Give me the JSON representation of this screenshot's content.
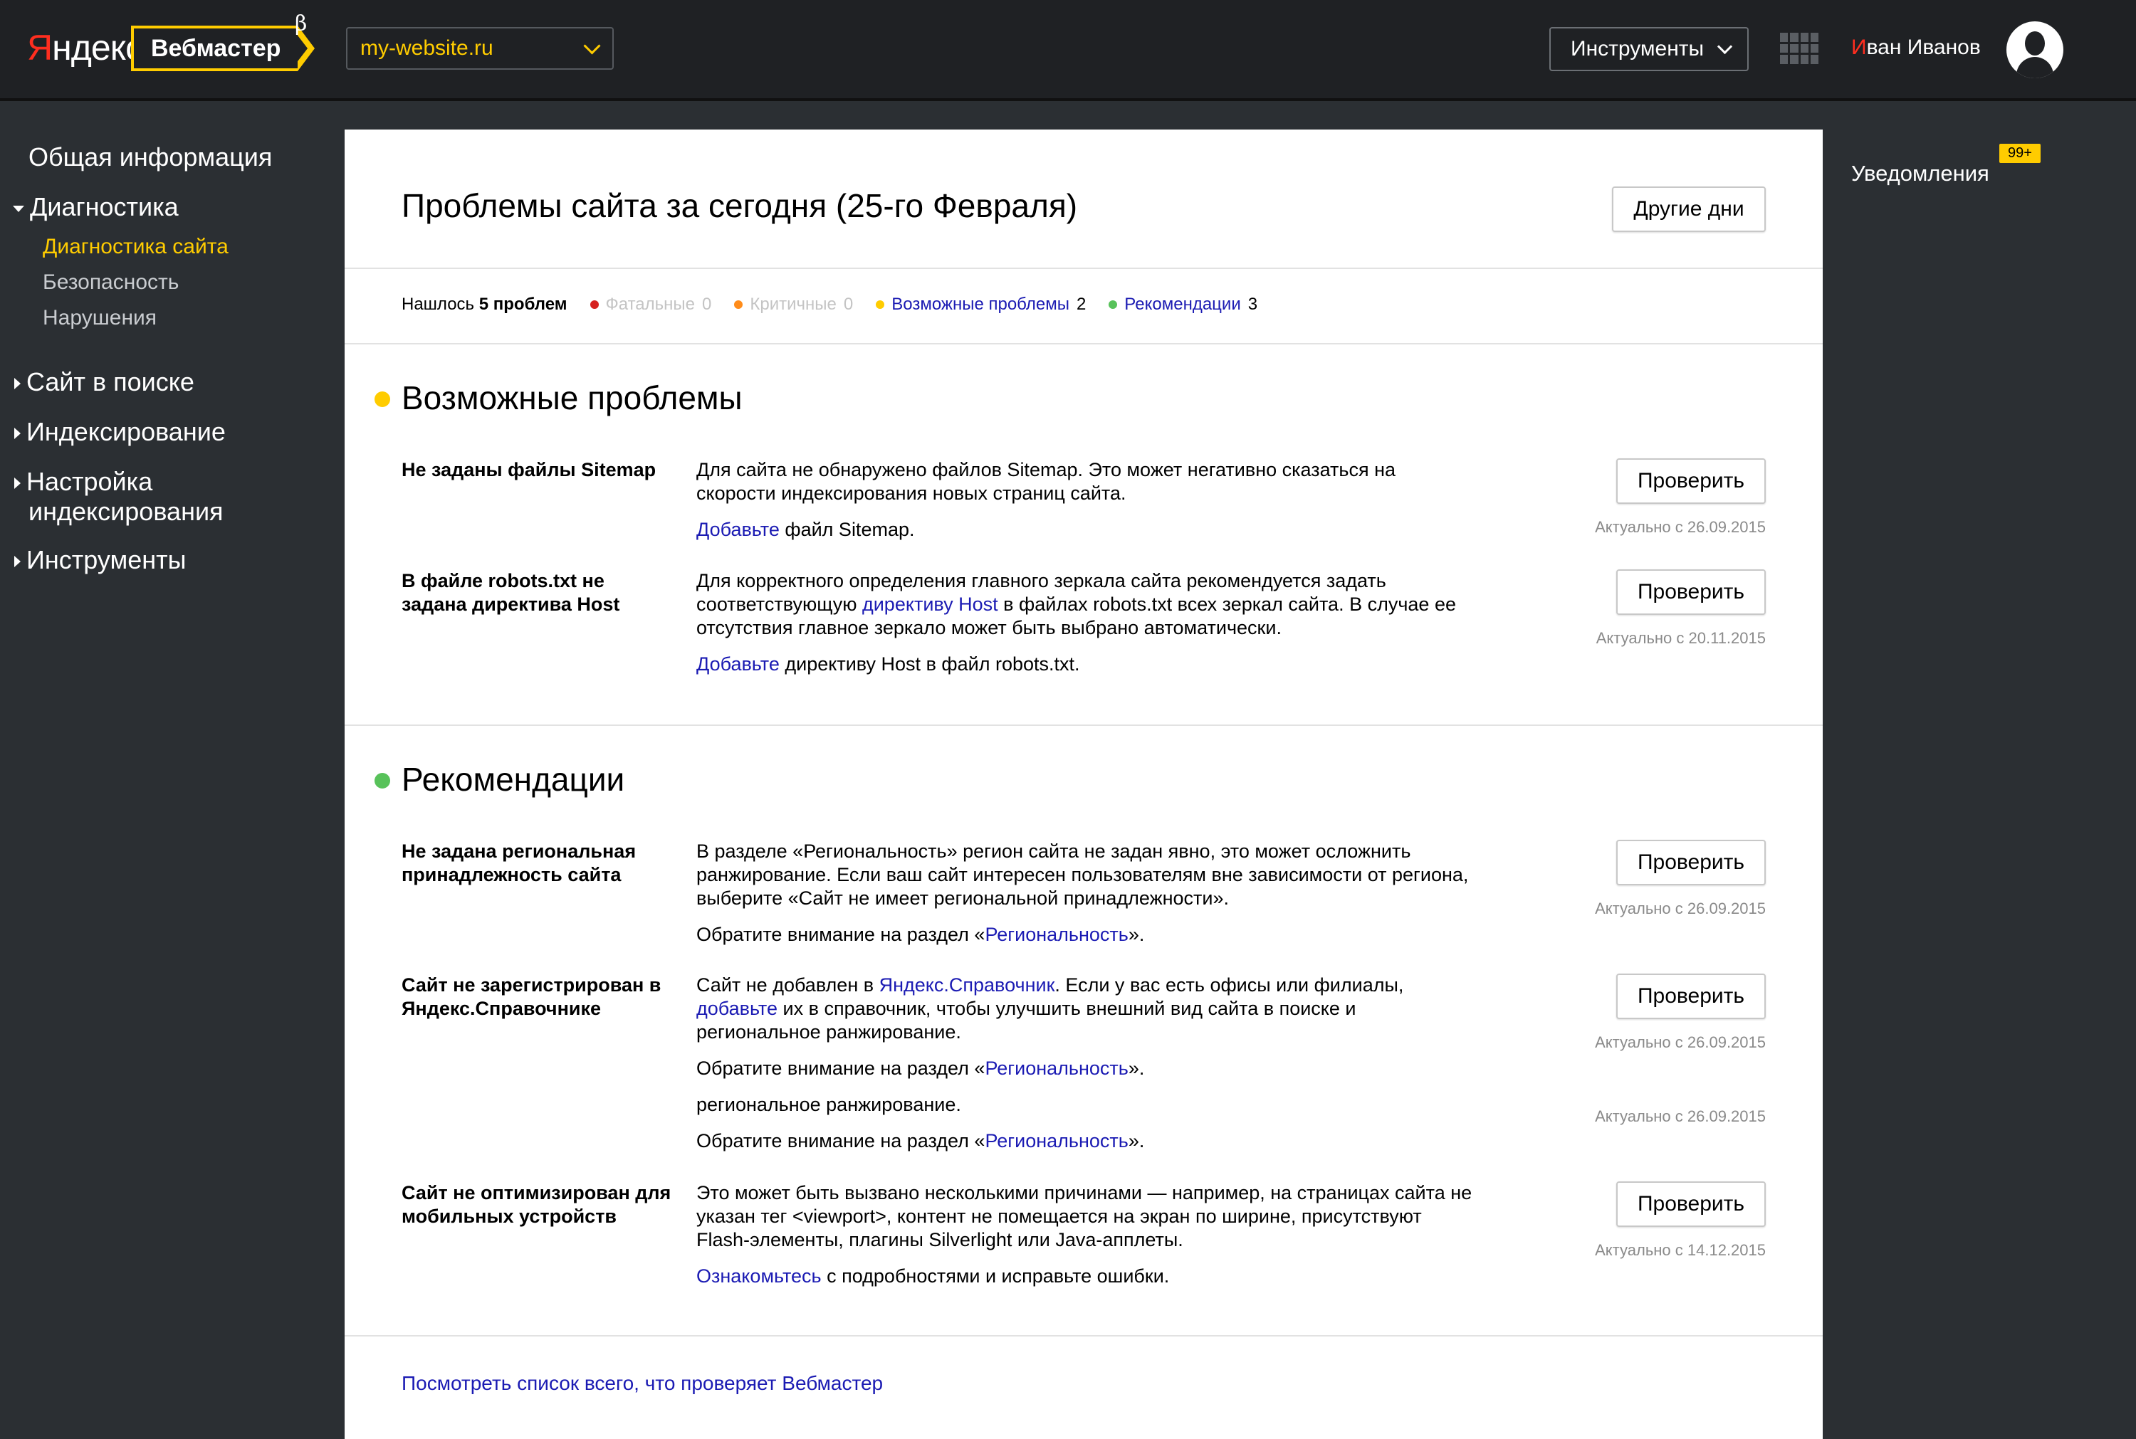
{
  "header": {
    "logo_first": "Я",
    "logo_rest": "ндекс",
    "product": "Вебмастер",
    "beta": "β",
    "site": "my-website.ru",
    "tools_label": "Инструменты",
    "user_first": "И",
    "user_rest": "ван Иванов"
  },
  "sidebar": {
    "general": "Общая информация",
    "diagnostics": "Диагностика",
    "diagnostics_sub": [
      "Диагностика сайта",
      "Безопасность",
      "Нарушения"
    ],
    "site_in_search": "Сайт в поиске",
    "indexing": "Индексирование",
    "indexing_settings_1": "Настройка",
    "indexing_settings_2": "индексирования",
    "tools": "Инструменты"
  },
  "notifications": {
    "label": "Уведомления",
    "badge": "99+"
  },
  "main": {
    "title": "Проблемы сайта за сегодня (25-го Февраля)",
    "other_days": "Другие дни",
    "summary": {
      "found_prefix": "Нашлось",
      "found_count": "5 проблем",
      "categories": [
        {
          "label": "Фатальные",
          "count": "0",
          "color": "#d6211f"
        },
        {
          "label": "Критичные",
          "count": "0",
          "color": "#ff8c1a"
        },
        {
          "label": "Возможные проблемы",
          "count": "2",
          "color": "#ffcc00"
        },
        {
          "label": "Рекомендации",
          "count": "3",
          "color": "#58c25a"
        }
      ]
    },
    "check_label": "Проверить",
    "possible": {
      "title": "Возможные проблемы",
      "color": "#ffcc00",
      "issues": [
        {
          "title": "Не заданы файлы Sitemap",
          "text1": "Для сайта не обнаружено файлов Sitemap. Это может негативно сказаться на скорости индексирования новых страниц сайта.",
          "link2": "Добавьте",
          "text2": " файл Sitemap.",
          "actual": "Актуально с 26.09.2015"
        },
        {
          "title": "В файле robots.txt не задана директива Host",
          "text1a": "Для корректного определения главного зеркала сайта рекомендуется задать соответствующую ",
          "link1": "директиву Host",
          "text1b": " в файлах robots.txt всех зеркал сайта. В случае ее отсутствия главное зеркало может быть выбрано автоматически.",
          "link2": "Добавьте",
          "text2": " директиву Host в файл robots.txt.",
          "actual": "Актуально с 20.11.2015"
        }
      ]
    },
    "recommendations": {
      "title": "Рекомендации",
      "color": "#58c25a",
      "issues": [
        {
          "title": "Не задана региональная принадлежность сайта",
          "text1": "В разделе «Региональность» регион сайта не задан явно, это может осложнить ранжирование. Если ваш сайт интересен пользователям вне зависимости от региона, выберите «Сайт не имеет региональной принадлежности».",
          "text2a": "Обратите внимание на раздел «",
          "link2": "Региональность",
          "text2b": "».",
          "actual": "Актуально с 26.09.2015"
        },
        {
          "title": "Сайт не зарегистрирован в Яндекс.Справочнике",
          "text1a": "Сайт не добавлен в ",
          "link1a": "Яндекс.Справочник",
          "text1b": ". Если у вас есть офисы или филиалы, ",
          "link1b": "добавьте",
          "text1c": " их в справочник, чтобы улучшить внешний вид сайта в поиске и региональное ранжирование.",
          "text2a": "Обратите внимание на раздел «",
          "link2": "Региональность",
          "text2b": "».",
          "text3": "региональное ранжирование.",
          "text4a": "Обратите внимание на раздел «",
          "link4": "Региональность",
          "text4b": "».",
          "actual": "Актуально с 26.09.2015",
          "actual2": "Актуально с 26.09.2015"
        },
        {
          "title": "Сайт не оптимизирован для мобильных устройств",
          "text1": "Это может быть вызвано несколькими причинами — например, на страницах сайта не указан тег <viewport>, контент не помещается на экран по ширине, присутствуют Flash-элементы, плагины Silverlight или Java-апплеты.",
          "link2": "Ознакомьтесь",
          "text2": " с подробностями и исправьте ошибки.",
          "actual": "Актуально с 14.12.2015"
        }
      ]
    },
    "footer_link": "Посмотреть список всего, что проверяет Вебмастер"
  }
}
